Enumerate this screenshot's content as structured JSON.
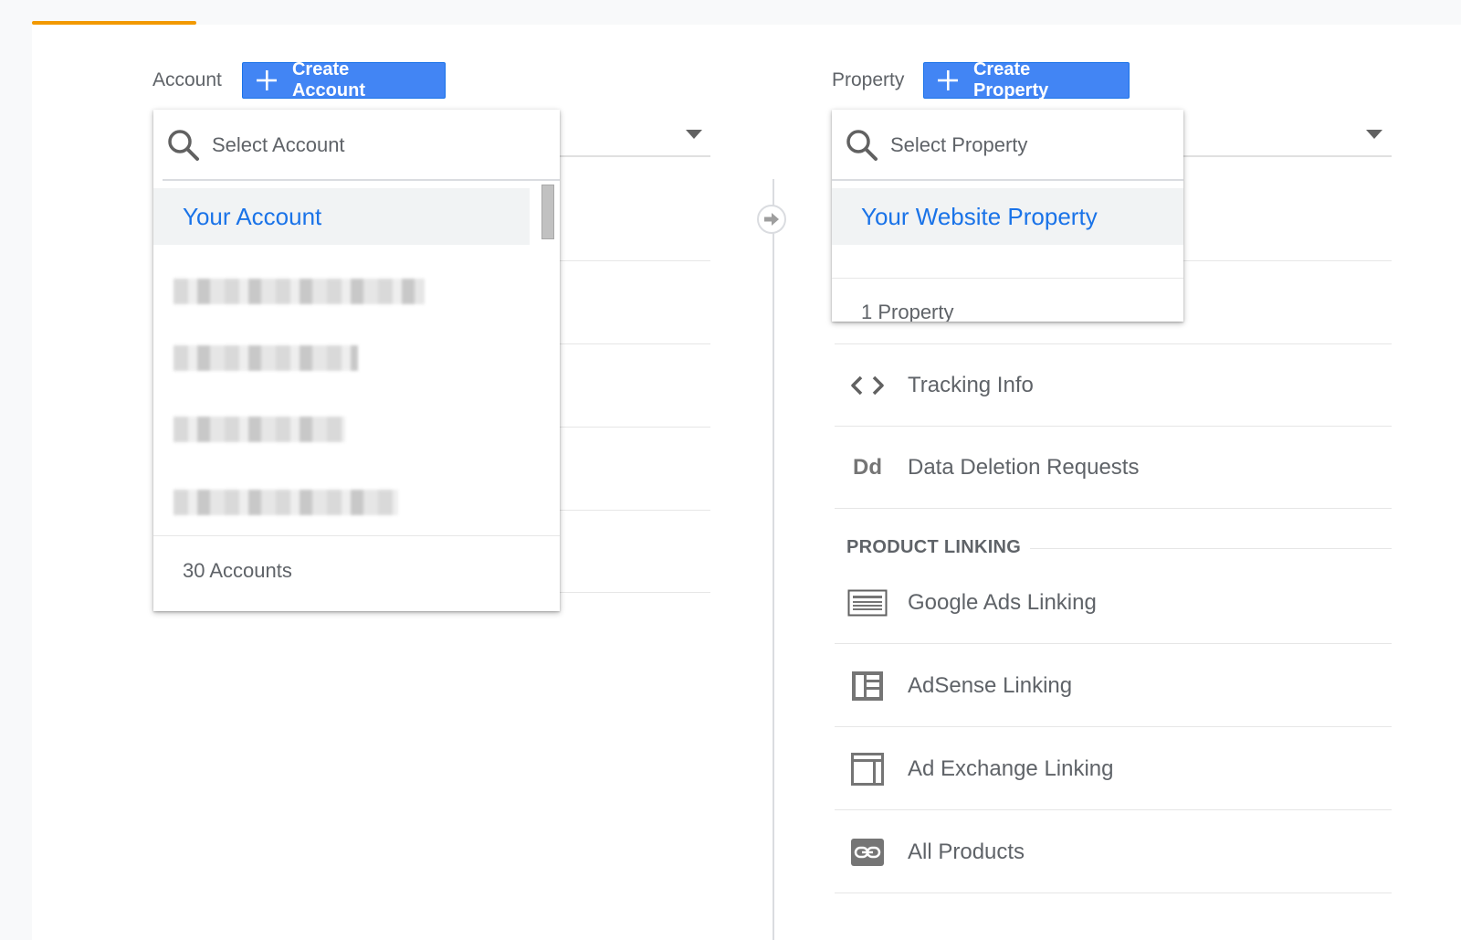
{
  "account": {
    "label": "Account",
    "create_button_label": "Create Account",
    "search_placeholder": "Select Account",
    "selected_item": "Your Account",
    "count_text": "30 Accounts"
  },
  "property": {
    "label": "Property",
    "create_button_label": "Create Property",
    "search_placeholder": "Select Property",
    "selected_item": "Your Website Property",
    "count_text": "1 Property"
  },
  "property_menu": {
    "items": [
      {
        "label": "Tracking Info",
        "icon": "code-brackets-icon"
      },
      {
        "label": "Data Deletion Requests",
        "icon": "dd-icon",
        "icon_text": "Dd"
      }
    ],
    "section_title": "PRODUCT LINKING",
    "linking_items": [
      {
        "label": "Google Ads Linking",
        "icon": "google-ads-icon"
      },
      {
        "label": "AdSense Linking",
        "icon": "adsense-icon"
      },
      {
        "label": "Ad Exchange Linking",
        "icon": "ad-exchange-icon"
      },
      {
        "label": "All Products",
        "icon": "link-icon"
      }
    ]
  },
  "colors": {
    "accent_orange": "#f29900",
    "button_blue": "#4285f4",
    "selected_text_blue": "#1a73e8",
    "text_gray": "#5f6368"
  }
}
